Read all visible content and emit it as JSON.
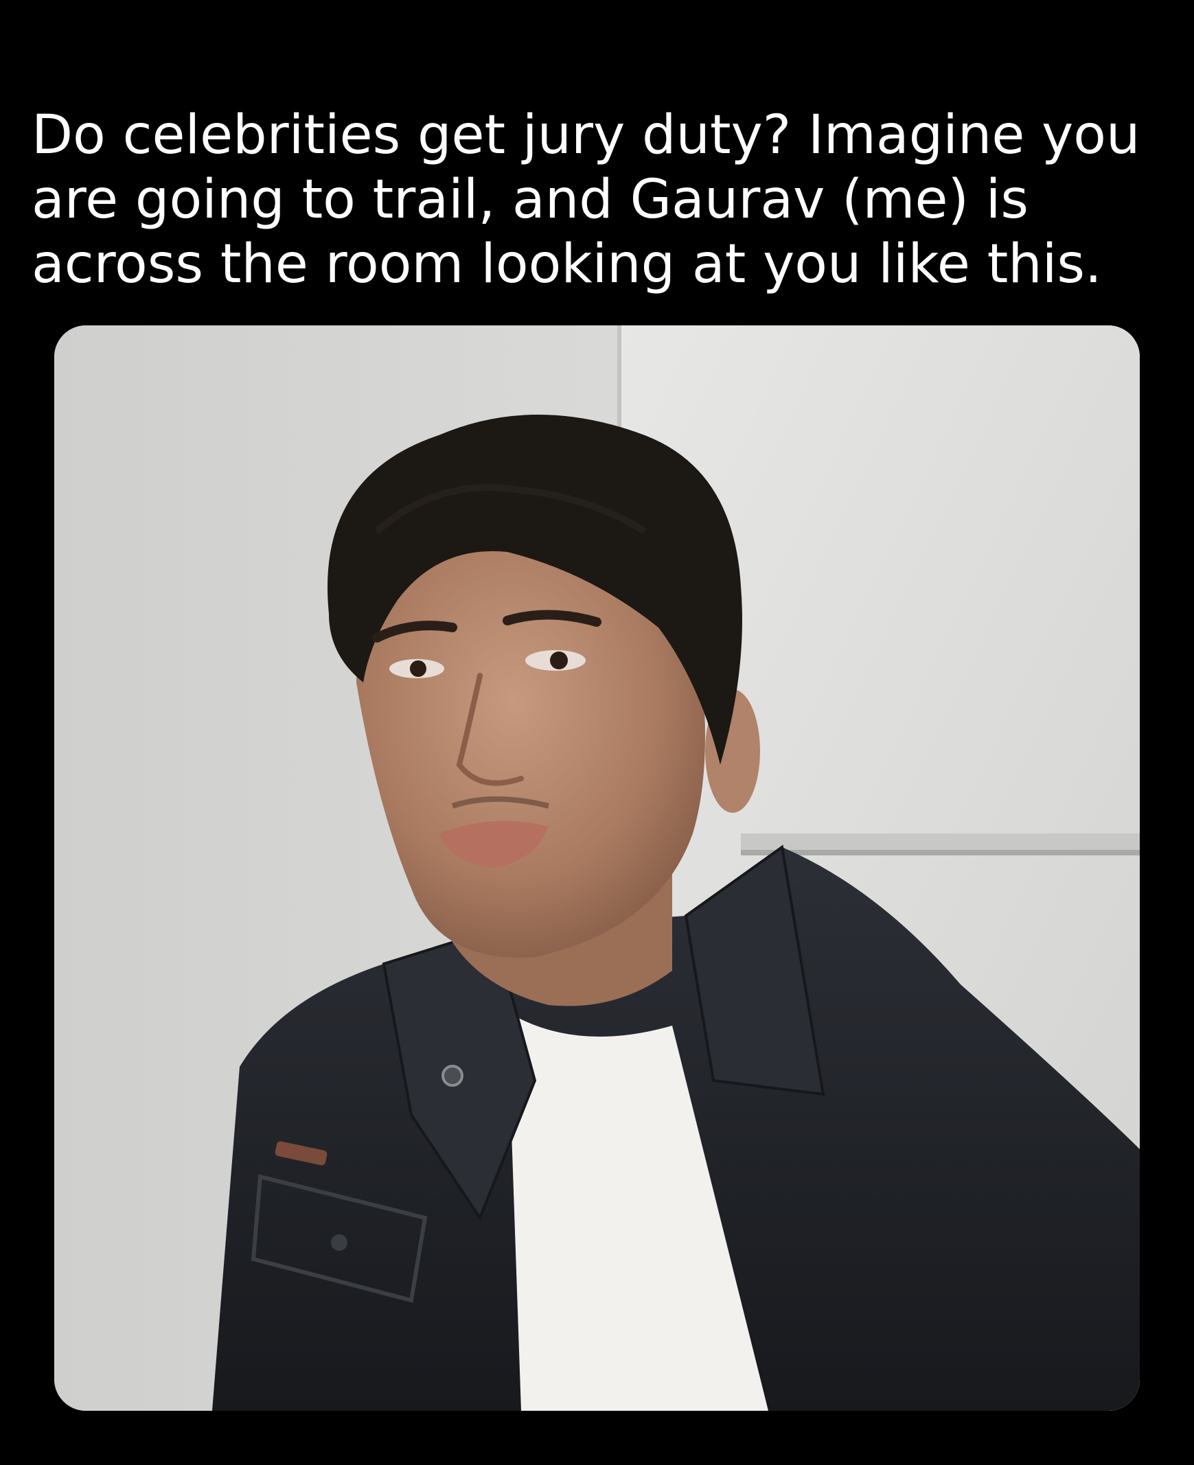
{
  "caption": {
    "lines": [
      "Do celebrities get jury duty? Imagine you",
      "are going to trail, and Gaurav (me) is",
      "across the room looking at you like this."
    ],
    "color": "#ffffff"
  },
  "photo": {
    "subject": "selfie-portrait",
    "background_color": "#000000",
    "wall_color": "#dcdcda",
    "jacket_color": "#22252b",
    "shirt_color": "#f2f1ee",
    "hair_color": "#1c1814",
    "skin_color": "#b98a70"
  }
}
